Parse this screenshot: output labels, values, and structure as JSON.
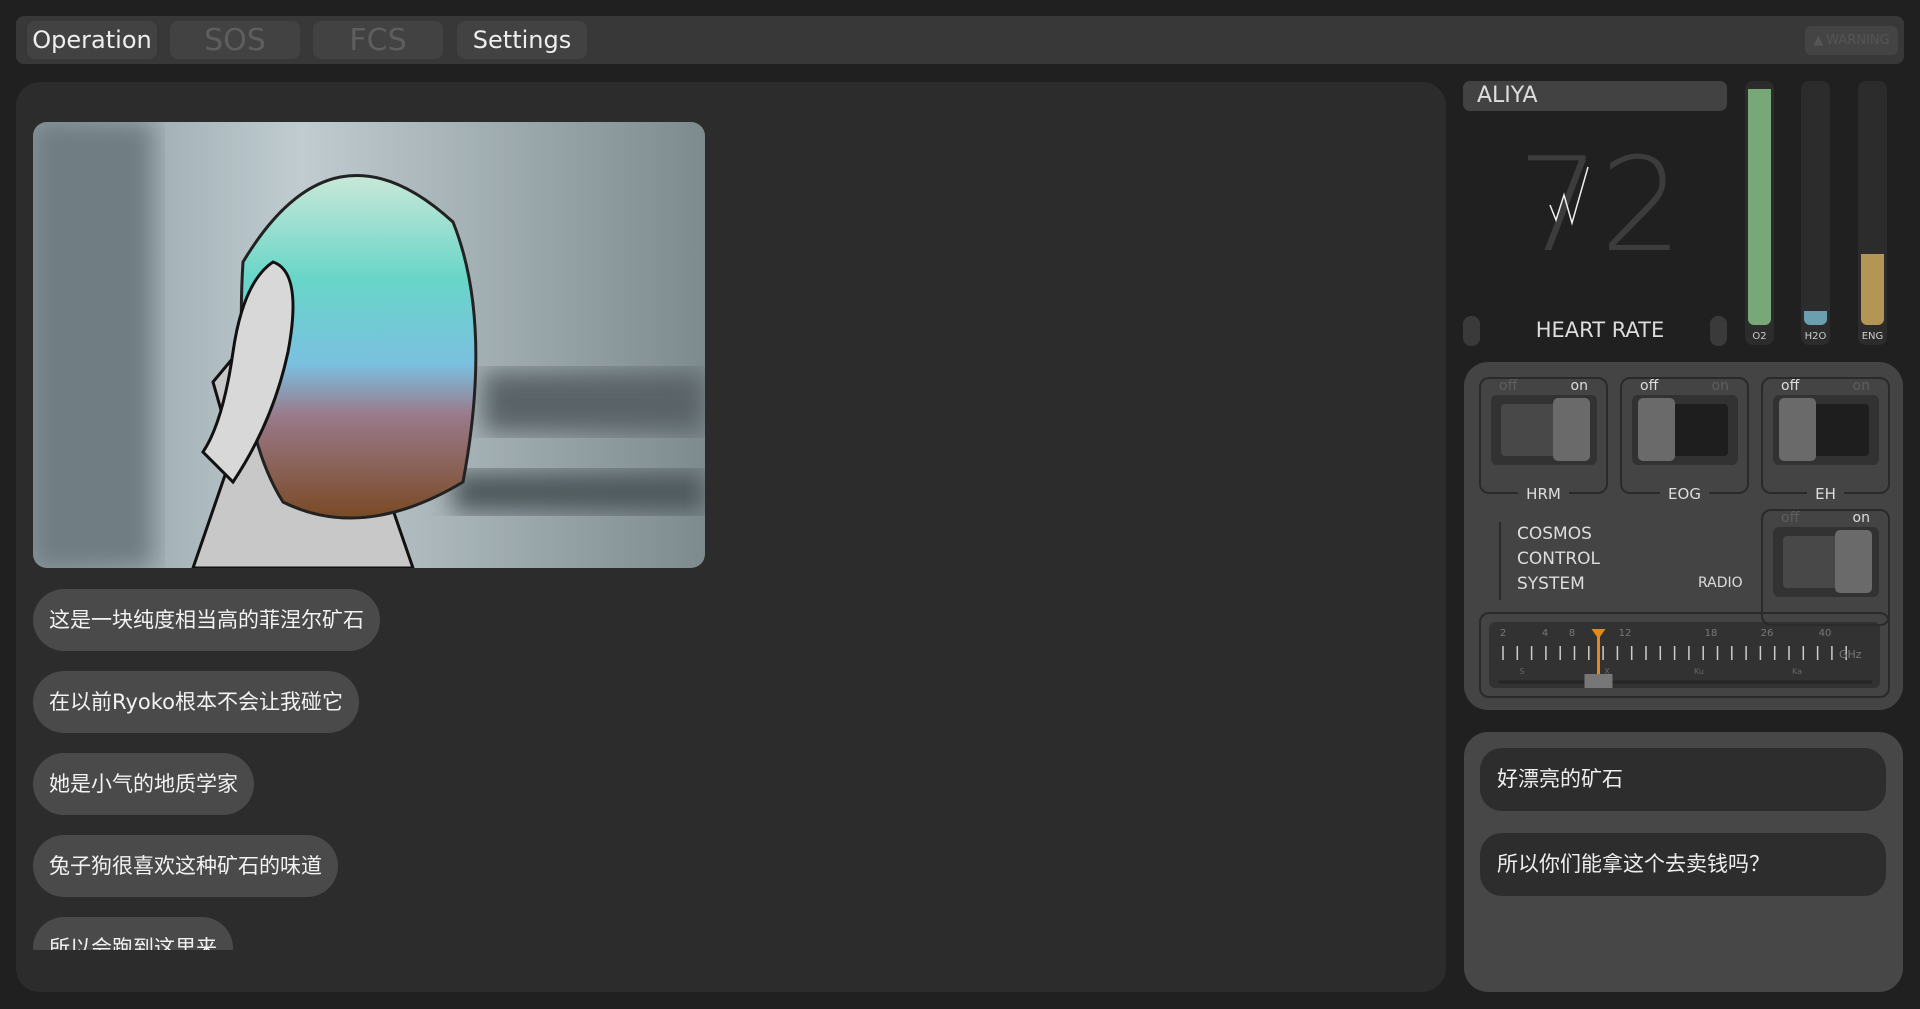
{
  "tabs": [
    {
      "label": "Operation",
      "enabled": true
    },
    {
      "label": "SOS",
      "enabled": false
    },
    {
      "label": "FCS",
      "enabled": false
    },
    {
      "label": "Settings",
      "enabled": true
    }
  ],
  "warning": {
    "icon": "warning-triangle-icon",
    "label": "WARNING"
  },
  "messages": [
    "这是一块纯度相当高的菲涅尔矿石",
    "在以前Ryoko根本不会让我碰它",
    "她是小气的地质学家",
    "兔子狗很喜欢这种矿石的味道",
    "所以会跑到这里来"
  ],
  "vitals": {
    "name": "ALIYA",
    "heart_rate": "72",
    "heart_rate_label": "HEART RATE",
    "gauges": [
      {
        "label": "O2",
        "level": 0.99,
        "color": "#78a878"
      },
      {
        "label": "H2O",
        "level": 0.06,
        "color": "#6b9fb0"
      },
      {
        "label": "ENG",
        "level": 0.3,
        "color": "#b39555"
      }
    ]
  },
  "controls": {
    "off_label": "off",
    "on_label": "on",
    "switches": [
      {
        "name": "HRM",
        "on": true
      },
      {
        "name": "EOG",
        "on": false
      },
      {
        "name": "EH",
        "on": false
      }
    ],
    "radio": {
      "name": "RADIO",
      "on": true
    },
    "system_lines": [
      "COSMOS",
      "CONTROL",
      "SYSTEM"
    ],
    "frequency": {
      "ticks": [
        "2",
        "4",
        "8",
        "12",
        "18",
        "26",
        "40"
      ],
      "unit": "GHz",
      "bands": [
        "S",
        "X",
        "Ku",
        "Ka"
      ],
      "value_ghz": 10,
      "accent": "#e08a20"
    }
  },
  "replies": [
    "好漂亮的矿石",
    "所以你们能拿这个去卖钱吗？"
  ]
}
